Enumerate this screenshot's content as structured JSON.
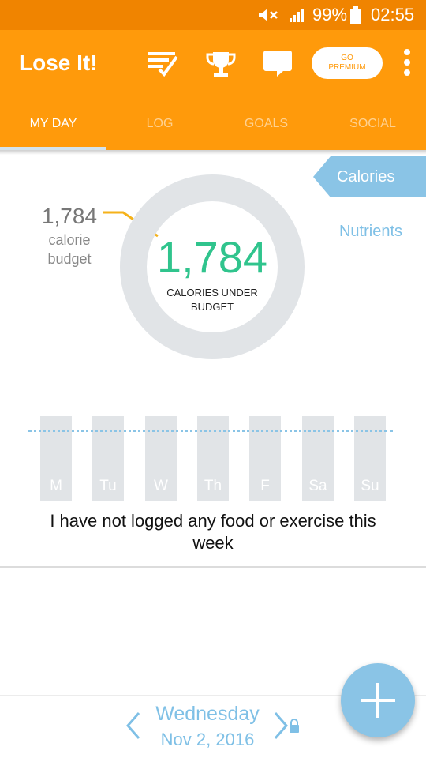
{
  "status_bar": {
    "battery_percent": "99%",
    "time": "02:55",
    "icons": [
      "mute-icon",
      "signal-icon",
      "battery-icon"
    ]
  },
  "app_bar": {
    "title": "Lose It!",
    "icons": [
      "checklist-icon",
      "trophy-icon",
      "chat-icon",
      "more-vert-icon"
    ],
    "premium_button": {
      "line1": "GO",
      "line2": "PREMIUM"
    }
  },
  "tabs": [
    {
      "label": "MY DAY",
      "active": true
    },
    {
      "label": "LOG",
      "active": false
    },
    {
      "label": "GOALS",
      "active": false
    },
    {
      "label": "SOCIAL",
      "active": false
    }
  ],
  "summary": {
    "view_tabs": {
      "calories": "Calories",
      "nutrients": "Nutrients"
    },
    "budget_value": "1,784",
    "budget_label_line1": "calorie",
    "budget_label_line2": "budget",
    "ring_value": "1,784",
    "ring_caption_line1": "CALORIES UNDER",
    "ring_caption_line2": "BUDGET",
    "ring_progress": 0
  },
  "week": {
    "days": [
      "M",
      "Tu",
      "W",
      "Th",
      "F",
      "Sa",
      "Su"
    ],
    "logged_fraction": [
      0,
      0,
      0,
      0,
      0,
      0,
      0
    ],
    "empty_message_line1": "I have not logged any food or exercise this",
    "empty_message_line2": "week"
  },
  "date_nav": {
    "weekday": "Wednesday",
    "date": "Nov 2, 2016",
    "icons": [
      "chevron-left-icon",
      "chevron-right-icon",
      "lock-icon"
    ]
  },
  "fab": {
    "icon": "plus-icon"
  },
  "colors": {
    "status_bar": "#f08400",
    "app_bar": "#ff9a0b",
    "accent_blue": "#8ac4e6",
    "calories_green": "#30c48d",
    "ring_track": "#e1e4e7",
    "budget_leader": "#f5b21a"
  }
}
